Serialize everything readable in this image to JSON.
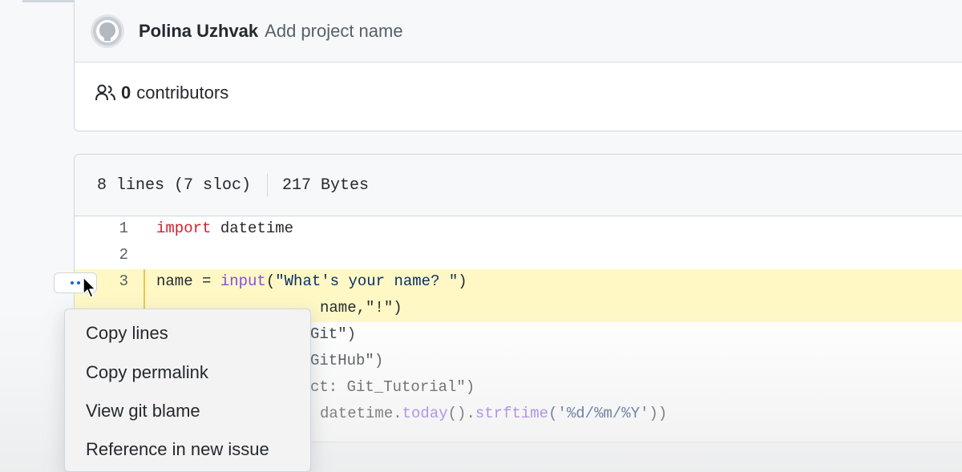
{
  "commit": {
    "author": "Polina Uzhvak",
    "message": "Add project name",
    "contributors_count": "0",
    "contributors_label": "contributors"
  },
  "file": {
    "lines_info": "8 lines (7 sloc)",
    "size": "217 Bytes",
    "line_numbers": [
      "1",
      "2",
      "3"
    ],
    "line3_code": "name = input(\"What's your name? \")",
    "line4_visible": "name,\"!\")",
    "line5_visible": "Git\")",
    "line6_visible": "GitHub\")",
    "line7_visible": "ct: Git_Tutorial\")",
    "line8_visible_prefix": "datetime.",
    "line8_visible_fn1": "today",
    "line8_visible_mid": "().",
    "line8_visible_fn2": "strftime",
    "line8_visible_str": "('%d/%m/%Y'",
    "line8_visible_end": "))"
  },
  "context_menu": {
    "items": [
      "Copy lines",
      "Copy permalink",
      "View git blame",
      "Reference in new issue"
    ]
  },
  "colors": {
    "highlight_line": "#fff8c5",
    "keyword": "#cf222e",
    "function": "#8250df",
    "link_blue": "#0969da"
  }
}
